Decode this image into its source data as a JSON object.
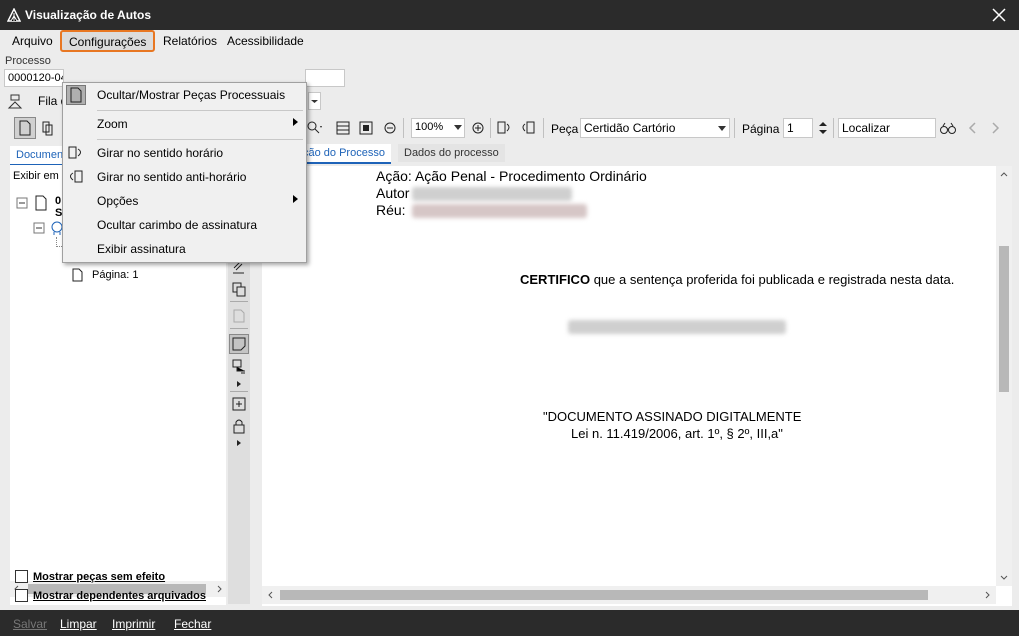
{
  "window": {
    "title": "Visualização de Autos"
  },
  "menubar": {
    "items": [
      "Arquivo",
      "Configurações",
      "Relatórios",
      "Acessibilidade"
    ]
  },
  "process": {
    "label": "Processo",
    "number": "0000120-04"
  },
  "queue_label": "Fila d",
  "toolbar": {
    "zoom": "100%",
    "peca_label": "Peça",
    "peca_value": "Certidão Cartório",
    "pagina_label": "Página",
    "pagina_value": "1",
    "search_placeholder": "Localizar"
  },
  "tabs": {
    "left": "Documen",
    "doc_tab": "ção do Processo",
    "data_tab": "Dados do processo"
  },
  "leftpane": {
    "filter": "Exibir em",
    "tree_item_a": "0",
    "tree_item_b": "S",
    "page_item": "Página: 1",
    "cb1": "Mostrar peças sem efeito",
    "cb2": "Mostrar dependentes arquivados"
  },
  "menu": {
    "items": [
      "Ocultar/Mostrar Peças Processuais",
      "Zoom",
      "Girar no sentido horário",
      "Girar no sentido anti-horário",
      "Opções",
      "Ocultar carimbo de assinatura",
      "Exibir assinatura"
    ]
  },
  "document": {
    "acao_label": "Ação:",
    "acao_value": "Ação Penal - Procedimento Ordinário",
    "autor_label": "Autor",
    "reu_label": "Réu:",
    "certifico_bold": "CERTIFICO",
    "certifico_text": "que a sentença proferida foi publicada e registrada nesta data.",
    "signed_line1": "\"DOCUMENTO ASSINADO DIGITALMENTE",
    "signed_line2": "Lei n. 11.419/2006, art. 1º, § 2º, III,a\""
  },
  "statusbar": {
    "items": [
      "Salvar",
      "Limpar",
      "Imprimir",
      "Fechar"
    ]
  }
}
